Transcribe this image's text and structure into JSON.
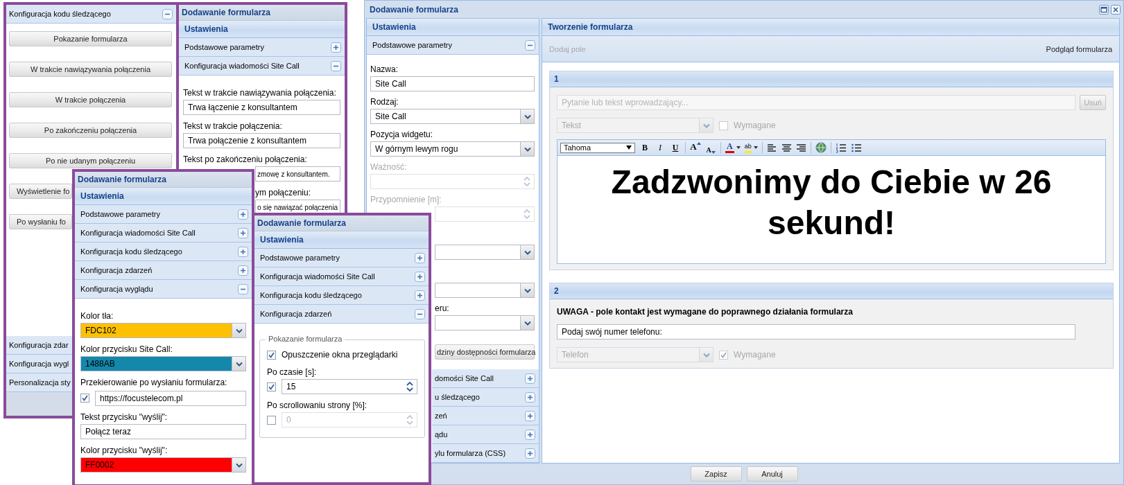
{
  "tracking_panel": {
    "header": {
      "title": "Konfiguracja kodu śledzącego",
      "expanded": true
    },
    "buttons": [
      {
        "kind": "button",
        "label": "Pokazanie formularza"
      },
      {
        "kind": "button",
        "label": "W trakcie nawiązywania połączenia"
      },
      {
        "kind": "button",
        "label": "W trakcie połączenia"
      },
      {
        "kind": "button",
        "label": "Po zakończeniu połączenia"
      },
      {
        "kind": "button",
        "label": "Po nie udanym połączeniu"
      },
      {
        "kind": "button_clipped",
        "label": "Wyświetlenie fo"
      },
      {
        "kind": "button_clipped",
        "label": "Po wysłaniu fo"
      }
    ],
    "sections": [
      "Konfiguracja zdar",
      "Konfiguracja wygl",
      "Personalizacja sty"
    ]
  },
  "message_panel": {
    "title": "Dodawanie formularza",
    "settings_title": "Ustawienia",
    "sections": [
      {
        "title": "Podstawowe parametry",
        "expanded": false
      },
      {
        "title": "Konfiguracja wiadomości Site Call",
        "expanded": true
      }
    ],
    "rows": [
      {
        "kind": "label",
        "text": "Tekst w trakcie nawiązywania połączenia:"
      },
      {
        "kind": "field",
        "value": "Trwa łączenie z konsultantem"
      },
      {
        "kind": "label",
        "text": "Tekst w trakcie połączenia:"
      },
      {
        "kind": "field",
        "value": "Trwa połączenie z konsultantem"
      },
      {
        "kind": "label",
        "text": "Tekst po zakończeniu połączenia:"
      },
      {
        "kind": "field_clipped",
        "value": "zmowę z konsultantem."
      },
      {
        "kind": "label_clipped",
        "text": "ym połączeniu:"
      },
      {
        "kind": "field_clipped",
        "value": "o się nawiązać połączenia"
      }
    ]
  },
  "appearance_panel": {
    "title": "Dodawanie formularza",
    "settings_title": "Ustawienia",
    "sections": [
      {
        "title": "Podstawowe parametry",
        "expanded": false
      },
      {
        "title": "Konfiguracja wiadomości Site Call",
        "expanded": false
      },
      {
        "title": "Konfiguracja kodu śledzącego",
        "expanded": false
      },
      {
        "title": "Konfiguracja zdarzeń",
        "expanded": false
      },
      {
        "title": "Konfiguracja wyglądu",
        "expanded": true
      }
    ],
    "rows": [
      {
        "kind": "label",
        "text": "Kolor tła:"
      },
      {
        "kind": "color_select",
        "value": "FDC102",
        "color": "#fdc102"
      },
      {
        "kind": "label",
        "text": "Kolor przycisku Site Call:"
      },
      {
        "kind": "color_select",
        "value": "1488AB",
        "color": "#1488ab"
      },
      {
        "kind": "label",
        "text": "Przekierowanie po wysłaniu formularza:"
      },
      {
        "kind": "checked_field",
        "checked": true,
        "value": "https://focustelecom.pl"
      },
      {
        "kind": "label",
        "text": "Tekst przycisku \"wyślij\":"
      },
      {
        "kind": "field",
        "value": "Połącz teraz"
      },
      {
        "kind": "label",
        "text": "Kolor przycisku \"wyślij\":"
      },
      {
        "kind": "color_select",
        "value": "FF0002",
        "color": "#ff0002"
      }
    ]
  },
  "events_panel": {
    "title": "Dodawanie formularza",
    "settings_title": "Ustawienia",
    "sections": [
      {
        "title": "Podstawowe parametry",
        "expanded": false
      },
      {
        "title": "Konfiguracja wiadomości Site Call",
        "expanded": false
      },
      {
        "title": "Konfiguracja kodu śledzącego",
        "expanded": false
      },
      {
        "title": "Konfiguracja zdarzeń",
        "expanded": true
      }
    ],
    "fieldset": {
      "legend": "Pokazanie formularza",
      "rows": [
        {
          "kind": "checkbox",
          "label": "Opuszczenie okna przeglądarki",
          "checked": true
        },
        {
          "kind": "label",
          "text": "Po czasie [s]:"
        },
        {
          "kind": "checked_spinner",
          "checked": true,
          "value": "15",
          "disabled": false
        },
        {
          "kind": "label",
          "text": "Po scrollowaniu strony [%]:"
        },
        {
          "kind": "checked_spinner",
          "checked": false,
          "value": "0",
          "disabled": true
        }
      ]
    }
  },
  "main_window": {
    "title": "Dodawanie formularza",
    "settings_title": "Ustawienia",
    "section": {
      "title": "Podstawowe parametry",
      "expanded": true
    },
    "rows": [
      {
        "kind": "label",
        "text": "Nazwa:",
        "disabled": false
      },
      {
        "kind": "field",
        "value": "Site Call",
        "disabled": false
      },
      {
        "kind": "label",
        "text": "Rodzaj:",
        "disabled": false
      },
      {
        "kind": "select",
        "value": "Site Call",
        "disabled": false
      },
      {
        "kind": "label",
        "text": "Pozycja widgetu:",
        "disabled": false
      },
      {
        "kind": "select",
        "value": "W górnym lewym rogu",
        "disabled": false
      },
      {
        "kind": "label",
        "text": "Ważność:",
        "disabled": true
      },
      {
        "kind": "spinner",
        "disabled": true
      },
      {
        "kind": "label",
        "text": "Przypomnienie [m]:",
        "disabled": true
      },
      {
        "kind": "spinner_clipped",
        "disabled": true
      },
      {
        "kind": "gap"
      },
      {
        "kind": "select_clipped",
        "disabled": false
      },
      {
        "kind": "gap"
      },
      {
        "kind": "select_clipped",
        "disabled": false
      },
      {
        "kind": "label_clipped",
        "text": "eru:",
        "disabled": false
      },
      {
        "kind": "select_clipped",
        "disabled": false
      },
      {
        "kind": "button_clipped",
        "label": "dziny dostępności formularza"
      }
    ],
    "sections": [
      {
        "title": "domości Site Call",
        "expanded": false
      },
      {
        "title": "u śledzącego",
        "expanded": false
      },
      {
        "title": "zeń",
        "expanded": false
      },
      {
        "title": "ądu",
        "expanded": false
      },
      {
        "title": "ylu formularza (CSS)",
        "expanded": false
      }
    ],
    "builder": {
      "title": "Tworzenie formularza",
      "add_button": {
        "label": "Dodaj pole",
        "disabled": true
      },
      "preview_button": "Podgląd formularza",
      "cards": [
        {
          "number": "1",
          "question": {
            "placeholder": "Pytanie lub tekst wprowadzający...",
            "disabled": true
          },
          "remove_button": "Usuń",
          "type": {
            "value": "Tekst",
            "disabled": true
          },
          "required": {
            "label": "Wymagane",
            "checked": false,
            "disabled": true
          },
          "editor": {
            "font": "Tahoma",
            "tools": [
              {
                "kind": "bold",
                "label": "B"
              },
              {
                "kind": "italic",
                "label": "I"
              },
              {
                "kind": "underline",
                "label": "U"
              },
              {
                "kind": "separator"
              },
              {
                "kind": "grow",
                "label": "A"
              },
              {
                "kind": "shrink",
                "label": "A"
              },
              {
                "kind": "separator"
              },
              {
                "kind": "font_color",
                "label": "A"
              },
              {
                "kind": "highlight",
                "label": "ab"
              },
              {
                "kind": "separator"
              },
              {
                "kind": "align_left"
              },
              {
                "kind": "align_center"
              },
              {
                "kind": "align_right"
              },
              {
                "kind": "separator"
              },
              {
                "kind": "link"
              },
              {
                "kind": "separator"
              },
              {
                "kind": "ordered_list"
              },
              {
                "kind": "bullet_list"
              }
            ],
            "content": "Zadzwonimy do Ciebie w 26 sekund!"
          }
        },
        {
          "number": "2",
          "note": "UWAGA - pole kontakt jest wymagane do poprawnego działania formularza",
          "question": {
            "value": "Podaj swój numer telefonu:",
            "disabled": false
          },
          "type": {
            "value": "Telefon",
            "disabled": true
          },
          "required": {
            "label": "Wymagane",
            "checked": true,
            "disabled": true
          }
        }
      ]
    },
    "footer_buttons": [
      "Zapisz",
      "Anuluj"
    ]
  }
}
